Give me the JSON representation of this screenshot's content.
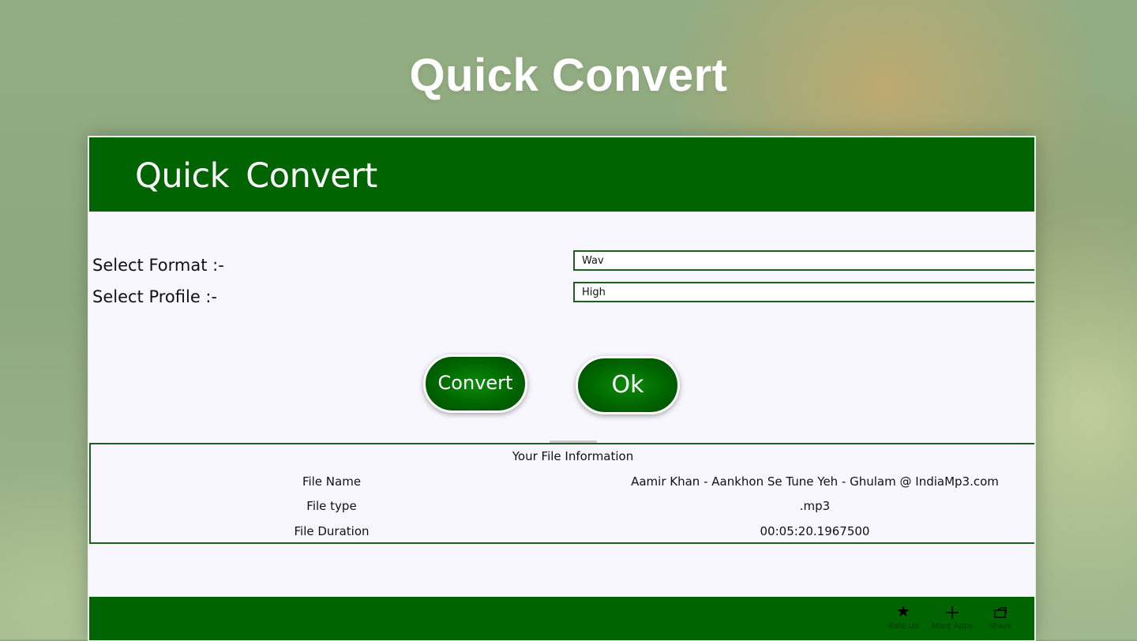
{
  "hero": {
    "title": "Quick Convert"
  },
  "app": {
    "title": "Quick  Convert",
    "format": {
      "label": "Select Format :-",
      "selected": "Wav"
    },
    "profile": {
      "label": "Select Profile :-",
      "selected": "High"
    },
    "buttons": {
      "convert": "Convert",
      "ok": "Ok"
    },
    "file_info": {
      "title": "Your File Information",
      "rows": [
        {
          "key": "File Name",
          "value": "Aamir Khan - Aankhon Se Tune Yeh - Ghulam @ IndiaMp3.com"
        },
        {
          "key": "File type",
          "value": ".mp3"
        },
        {
          "key": "File Duration",
          "value": "00:05:20.1967500"
        }
      ]
    },
    "footer": {
      "actions": [
        {
          "label": "Rate Us",
          "icon": "star-icon"
        },
        {
          "label": "More Apps",
          "icon": "plus-icon"
        },
        {
          "label": "Share",
          "icon": "share-icon"
        }
      ]
    }
  },
  "colors": {
    "brand_green": "#006400",
    "panel_background": "#f7f7fd"
  }
}
